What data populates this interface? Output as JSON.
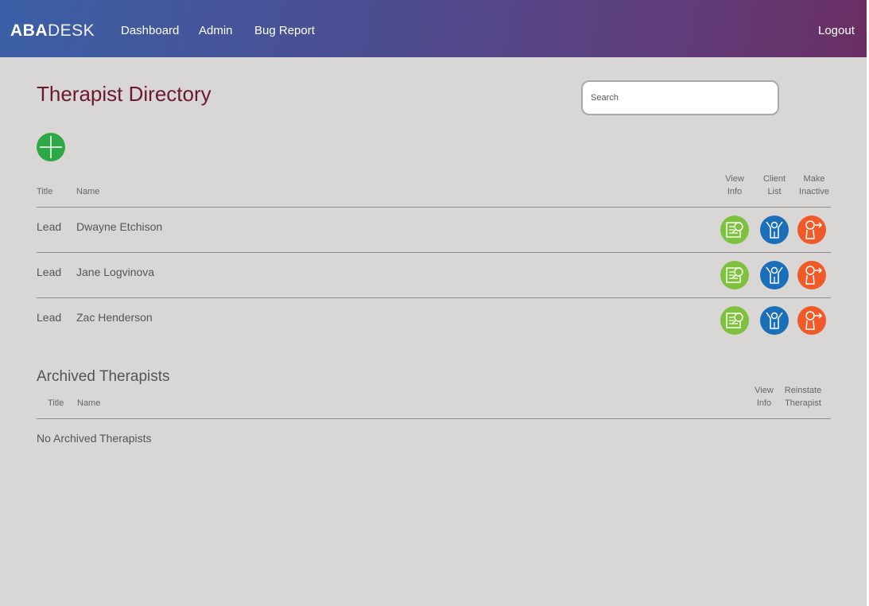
{
  "header": {
    "brand_bold": "ABA",
    "brand_light": "DESK",
    "nav": [
      "Dashboard",
      "Admin",
      "Bug Report"
    ],
    "logout": "Logout"
  },
  "directory": {
    "title": "Therapist Directory",
    "search_placeholder": "Search",
    "columns": {
      "title": "Title",
      "name": "Name",
      "view_info": [
        "View",
        "Info"
      ],
      "client_list": [
        "Client",
        "List"
      ],
      "make_inactive": [
        "Make",
        "Inactive"
      ]
    },
    "rows": [
      {
        "title": "Lead",
        "name": "Dwayne Etchison"
      },
      {
        "title": "Lead",
        "name": "Jane Logvinova"
      },
      {
        "title": "Lead",
        "name": "Zac Henderson"
      }
    ],
    "icons": {
      "add": "plus-icon",
      "view": "notepad-search-icon",
      "clients": "child-figure-icon",
      "inactive": "person-exit-icon"
    }
  },
  "archived": {
    "title": "Archived Therapists",
    "columns": {
      "title": "Title",
      "name": "Name",
      "view_info": [
        "View",
        "Info"
      ],
      "reinstate": [
        "Reinstate",
        "Therapist"
      ]
    },
    "empty_message": "No Archived Therapists"
  },
  "colors": {
    "view": "#7fc13f",
    "clients": "#1b6fb8",
    "inactive": "#ef5a28",
    "add": "#2da844",
    "title": "#6b1a2e"
  }
}
